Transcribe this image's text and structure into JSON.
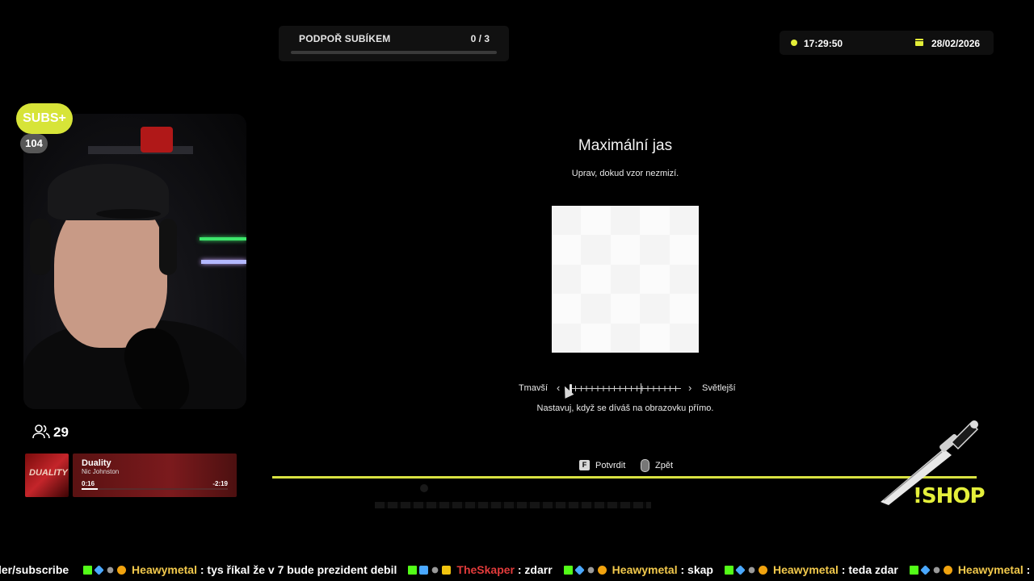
{
  "sub_goal": {
    "label": "PODPOŘ SUBÍKEM",
    "count": "0 / 3",
    "progress_fraction": 0.0
  },
  "clock": {
    "time": "17:29:50",
    "date": "28/02/2026"
  },
  "webcam": {
    "subs_badge": "SUBS+",
    "subs_count": "104"
  },
  "viewers": {
    "count": "29",
    "icon": "users-icon"
  },
  "now_playing": {
    "title": "Duality",
    "artist": "Nic Johnston",
    "elapsed": "0:16",
    "remaining": "-2:19",
    "album_art_text": "DUALITY",
    "progress_fraction": 0.11
  },
  "settings": {
    "title": "Maximální jas",
    "subtitle": "Uprav, dokud vzor nezmizí.",
    "slider": {
      "left_label": "Tmavší",
      "right_label": "Světlejší",
      "value_fraction": 0.0,
      "left_arrow": "‹",
      "right_arrow": "›"
    },
    "hint": "Nastavuj, když se díváš na obrazovku přímo.",
    "prompts": [
      {
        "key": "F",
        "label": "Potvrdit"
      },
      {
        "key": "mouse-icon",
        "label": "Zpět"
      }
    ]
  },
  "shop": {
    "label": "!SHOP",
    "icon": "dagger-icon"
  },
  "colors": {
    "accent": "#d9e241",
    "song_bg": "#7b1a1d"
  },
  "chat": {
    "prefix": "ler/subscribe",
    "messages": [
      {
        "user": "Heawymetal",
        "text": "tys říkal že v 7 bude prezident debil",
        "badges": [
          "kick-icon",
          "cube-icon",
          "gear-icon",
          "coin-icon"
        ]
      },
      {
        "user": "TheSkaper",
        "text": "zdarr",
        "badges": [
          "kick-icon",
          "pen-icon",
          "gear-icon",
          "crown-icon"
        ],
        "color": "red"
      },
      {
        "user": "Heawymetal",
        "text": "skap",
        "badges": [
          "kick-icon",
          "cube-icon",
          "gear-icon",
          "coin-icon"
        ]
      },
      {
        "user": "Heawymetal",
        "text": "teda zdar",
        "badges": [
          "kick-icon",
          "cube-icon",
          "gear-icon",
          "coin-icon"
        ]
      },
      {
        "user": "Heawymetal",
        "text": "",
        "badges": [
          "kick-icon",
          "cube-icon",
          "gear-icon",
          "coin-icon"
        ]
      }
    ]
  }
}
